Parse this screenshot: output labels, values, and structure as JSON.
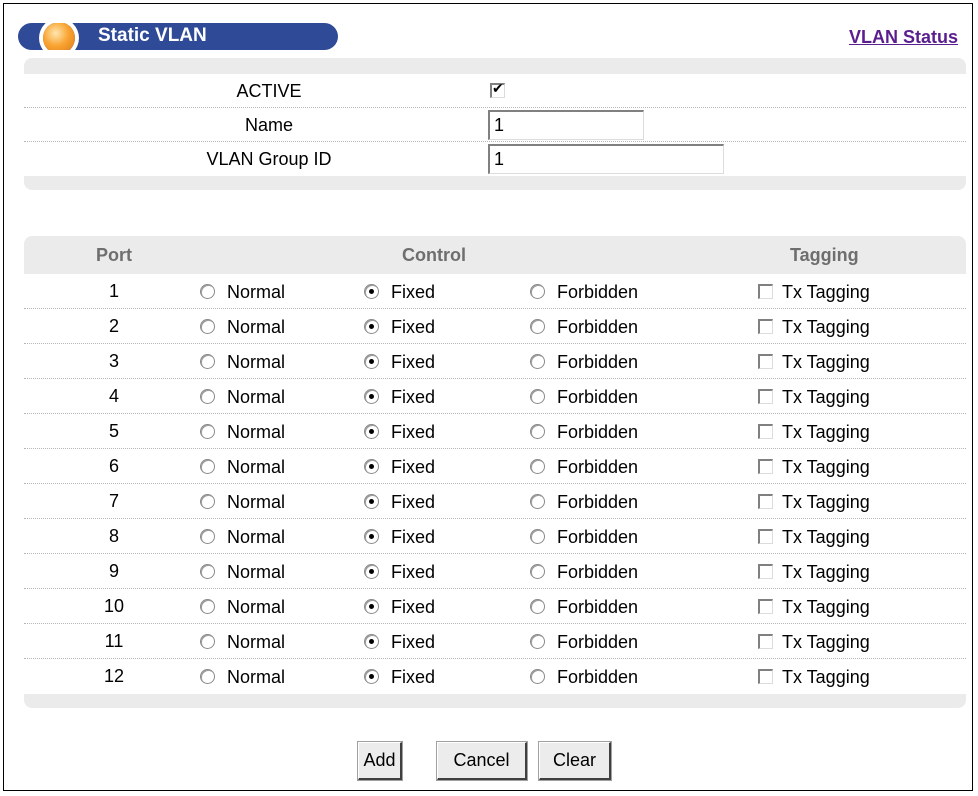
{
  "header": {
    "title": "Static VLAN",
    "link_label": "VLAN Status"
  },
  "form": {
    "active_label": "ACTIVE",
    "active_checked": true,
    "name_label": "Name",
    "name_value": "1",
    "group_id_label": "VLAN Group ID",
    "group_id_value": "1"
  },
  "ports_table": {
    "col_port": "Port",
    "col_control": "Control",
    "col_tagging": "Tagging",
    "option_normal": "Normal",
    "option_fixed": "Fixed",
    "option_forbidden": "Forbidden",
    "option_tx_tagging": "Tx Tagging",
    "rows": [
      {
        "port": "1",
        "control": "Fixed",
        "tx_tagging": false
      },
      {
        "port": "2",
        "control": "Fixed",
        "tx_tagging": false
      },
      {
        "port": "3",
        "control": "Fixed",
        "tx_tagging": false
      },
      {
        "port": "4",
        "control": "Fixed",
        "tx_tagging": false
      },
      {
        "port": "5",
        "control": "Fixed",
        "tx_tagging": false
      },
      {
        "port": "6",
        "control": "Fixed",
        "tx_tagging": false
      },
      {
        "port": "7",
        "control": "Fixed",
        "tx_tagging": false
      },
      {
        "port": "8",
        "control": "Fixed",
        "tx_tagging": false
      },
      {
        "port": "9",
        "control": "Fixed",
        "tx_tagging": false
      },
      {
        "port": "10",
        "control": "Fixed",
        "tx_tagging": false
      },
      {
        "port": "11",
        "control": "Fixed",
        "tx_tagging": false
      },
      {
        "port": "12",
        "control": "Fixed",
        "tx_tagging": false
      }
    ]
  },
  "buttons": {
    "add": "Add",
    "cancel": "Cancel",
    "clear": "Clear"
  },
  "colors": {
    "title_bar": "#2f4b97",
    "link": "#5a1e8e",
    "panel_bg": "#ebebeb"
  }
}
